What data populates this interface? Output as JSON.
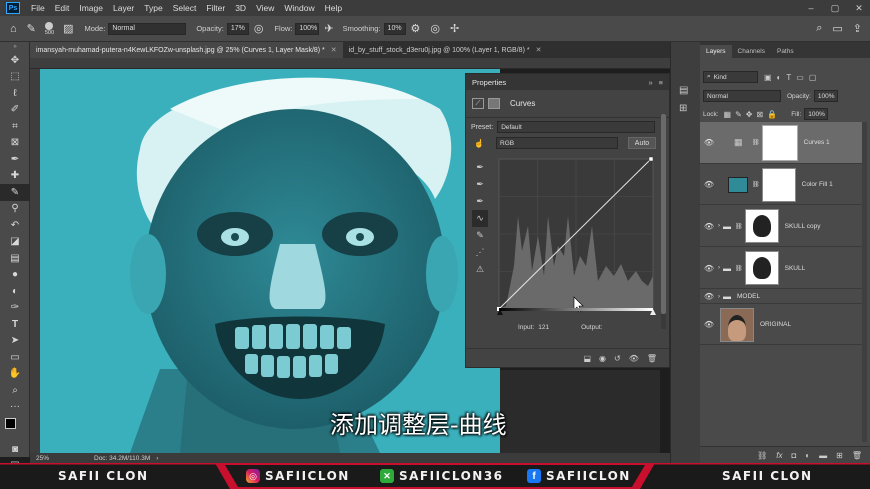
{
  "menu": {
    "logo": "Ps",
    "items": [
      "File",
      "Edit",
      "Image",
      "Layer",
      "Type",
      "Select",
      "Filter",
      "3D",
      "View",
      "Window",
      "Help"
    ]
  },
  "options": {
    "brush_size": "500",
    "mode_label": "Mode:",
    "mode_value": "Normal",
    "opacity_label": "Opacity:",
    "opacity_value": "17%",
    "flow_label": "Flow:",
    "flow_value": "100%",
    "smoothing_label": "Smoothing:",
    "smoothing_value": "10%"
  },
  "tabs": [
    {
      "label": "imansyah-muhamad-putera-n4KewLKFOZw-unsplash.jpg @ 25% (Curves 1, Layer Mask/8) *"
    },
    {
      "label": "id_by_stuff_stock_d3eru0j.jpg @ 100% (Layer 1, RGB/8) *"
    }
  ],
  "status": {
    "zoom": "25%",
    "doc": "Doc: 34.2M/110.3M"
  },
  "properties": {
    "title": "Properties",
    "adjustment_name": "Curves",
    "preset_label": "Preset:",
    "preset_value": "Default",
    "channel_value": "RGB",
    "auto_label": "Auto",
    "input_label": "Input:",
    "input_value": "121",
    "output_label": "Output:",
    "output_value": ""
  },
  "layers_panel": {
    "tabs": [
      "Layers",
      "Channels",
      "Paths"
    ],
    "kind_label": "Kind",
    "blend_mode": "Normal",
    "opacity_label": "Opacity:",
    "opacity_value": "100%",
    "lock_label": "Lock:",
    "fill_label": "Fill:",
    "fill_value": "100%",
    "layers": [
      {
        "name": "Curves 1",
        "selected": true
      },
      {
        "name": "Color Fill 1",
        "selected": false
      },
      {
        "name": "SKULL copy",
        "selected": false
      },
      {
        "name": "SKULL",
        "selected": false
      },
      {
        "name": "MODEL",
        "selected": false
      },
      {
        "name": "ORIGINAL",
        "selected": false
      }
    ]
  },
  "subtitle": "添加调整层-曲线",
  "banner": {
    "left": "SAFII CLON",
    "instagram": "SAFIICLON",
    "xbox": "SAFIICLON36",
    "facebook": "SAFIICLON",
    "right": "SAFII CLON"
  },
  "colors": {
    "canvas_cyan": "#3bb0bd",
    "accent_red": "#c8102e",
    "ps_blue": "#31a8ff",
    "panel_gray": "#4a4a4a"
  }
}
